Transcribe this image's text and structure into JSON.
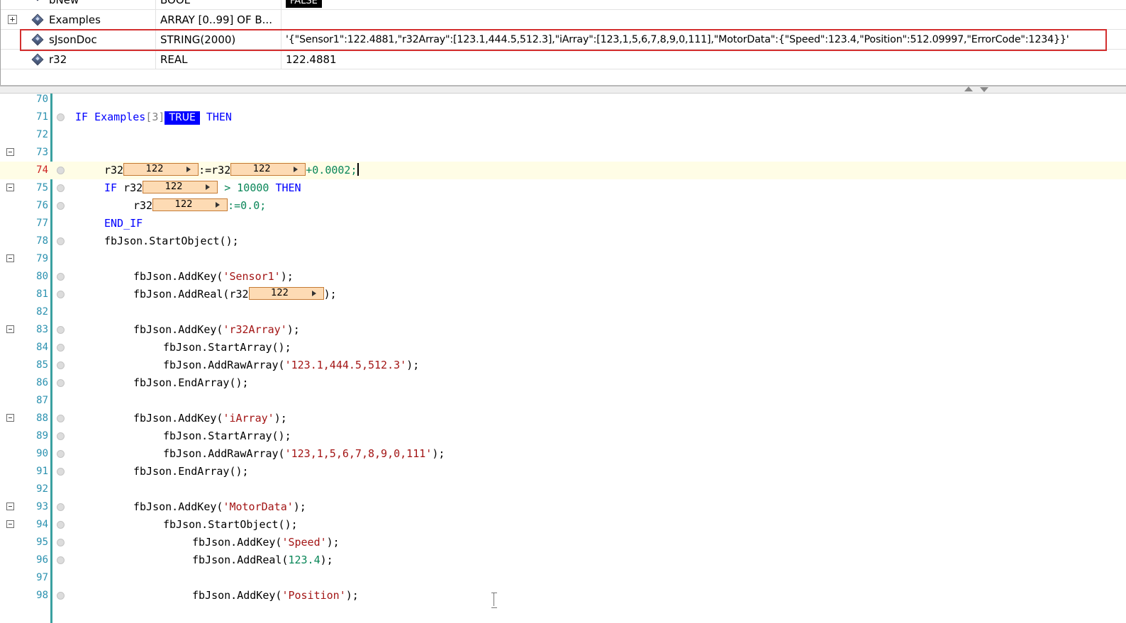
{
  "watch": {
    "rows": [
      {
        "name": "bNew",
        "type": "BOOL",
        "value": "FALSE",
        "expandable": false
      },
      {
        "name": "Examples",
        "type": "ARRAY [0..99] OF B...",
        "value": "",
        "expandable": true
      },
      {
        "name": "sJsonDoc",
        "type": "STRING(2000)",
        "value": "'{\"Sensor1\":122.4881,\"r32Array\":[123.1,444.5,512.3],\"iArray\":[123,1,5,6,7,8,9,0,111],\"MotorData\":{\"Speed\":123.4,\"Position\":512.09997,\"ErrorCode\":1234}}'",
        "expandable": false
      },
      {
        "name": "r32",
        "type": "REAL",
        "value": "122.4881",
        "expandable": false
      }
    ],
    "expand_symbol": "+"
  },
  "editor": {
    "monitor_value": "122",
    "true_badge": "TRUE",
    "line_numbers": [
      "70",
      "71",
      "72",
      "73",
      "74",
      "75",
      "76",
      "77",
      "78",
      "79",
      "80",
      "81",
      "82",
      "83",
      "84",
      "85",
      "86",
      "87",
      "88",
      "89",
      "90",
      "91",
      "92",
      "93",
      "94",
      "95",
      "96",
      "97",
      "98"
    ],
    "lines": {
      "l71_a": "IF Examples",
      "l71_idx": "[3]",
      "l71_then": "THEN",
      "l74_a": "r32",
      "l74_b": ":=r32",
      "l74_c": "+0.0002;",
      "l75_if": "IF",
      "l75_a": "r32",
      "l75_b": "> 10000",
      "l75_then": "THEN",
      "l76_a": "r32",
      "l76_b": ":=0.0;",
      "l77": "END_IF",
      "l78": "fbJson.StartObject();",
      "l80_a": "fbJson.AddKey(",
      "l80_s": "'Sensor1'",
      "l80_b": ");",
      "l81_a": "fbJson.AddReal(r32",
      "l81_b": ");",
      "l83_a": "fbJson.AddKey(",
      "l83_s": "'r32Array'",
      "l83_b": ");",
      "l84": "fbJson.StartArray();",
      "l85_a": "fbJson.AddRawArray(",
      "l85_s": "'123.1,444.5,512.3'",
      "l85_b": ");",
      "l86": "fbJson.EndArray();",
      "l88_a": "fbJson.AddKey(",
      "l88_s": "'iArray'",
      "l88_b": ");",
      "l89": "fbJson.StartArray();",
      "l90_a": "fbJson.AddRawArray(",
      "l90_s": "'123,1,5,6,7,8,9,0,111'",
      "l90_b": ");",
      "l91": "fbJson.EndArray();",
      "l93_a": "fbJson.AddKey(",
      "l93_s": "'MotorData'",
      "l93_b": ");",
      "l94": "fbJson.StartObject();",
      "l95_a": "fbJson.AddKey(",
      "l95_s": "'Speed'",
      "l95_b": ");",
      "l96_a": "fbJson.AddReal(",
      "l96_n": "123.4",
      "l96_b": ");",
      "l98_a": "fbJson.AddKey(",
      "l98_s": "'Position'",
      "l98_b": ");"
    }
  }
}
